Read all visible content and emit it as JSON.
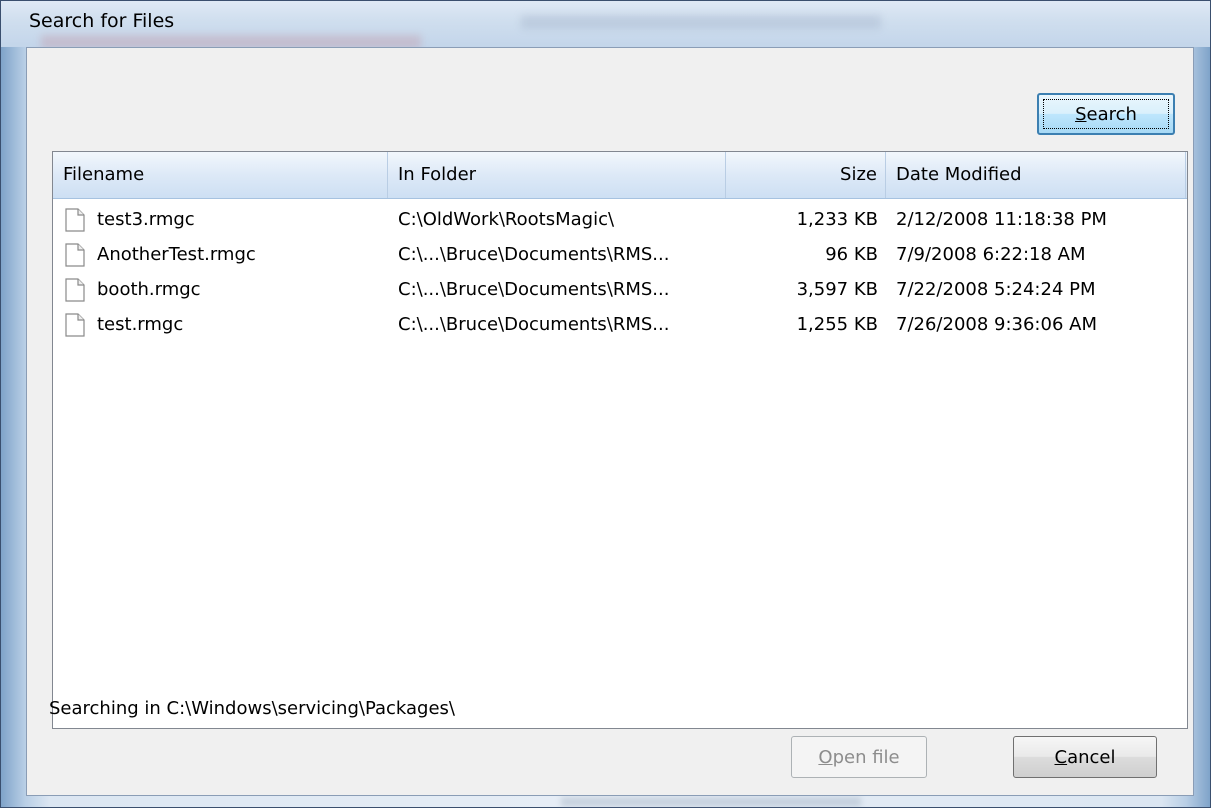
{
  "window": {
    "title": "Search for Files"
  },
  "buttons": {
    "search_label": "Search",
    "search_accel": "S",
    "search_rest": "earch",
    "open_accel": "O",
    "open_rest": "pen file",
    "cancel_accel": "C",
    "cancel_rest": "ancel"
  },
  "table": {
    "columns": [
      "Filename",
      "In Folder",
      "Size",
      "Date Modified"
    ],
    "rows": [
      {
        "filename": "test3.rmgc",
        "folder": "C:\\OldWork\\RootsMagic\\",
        "size": "1,233 KB",
        "date": "2/12/2008 11:18:38 PM"
      },
      {
        "filename": "AnotherTest.rmgc",
        "folder": "C:\\...\\Bruce\\Documents\\RMS...",
        "size": "96 KB",
        "date": "7/9/2008 6:22:18 AM"
      },
      {
        "filename": "booth.rmgc",
        "folder": "C:\\...\\Bruce\\Documents\\RMS...",
        "size": "3,597 KB",
        "date": "7/22/2008 5:24:24 PM"
      },
      {
        "filename": "test.rmgc",
        "folder": "C:\\...\\Bruce\\Documents\\RMS...",
        "size": "1,255 KB",
        "date": "7/26/2008 9:36:06 AM"
      }
    ]
  },
  "status": {
    "text": "Searching in C:\\Windows\\servicing\\Packages\\"
  },
  "icons": {
    "file": "file-icon"
  }
}
